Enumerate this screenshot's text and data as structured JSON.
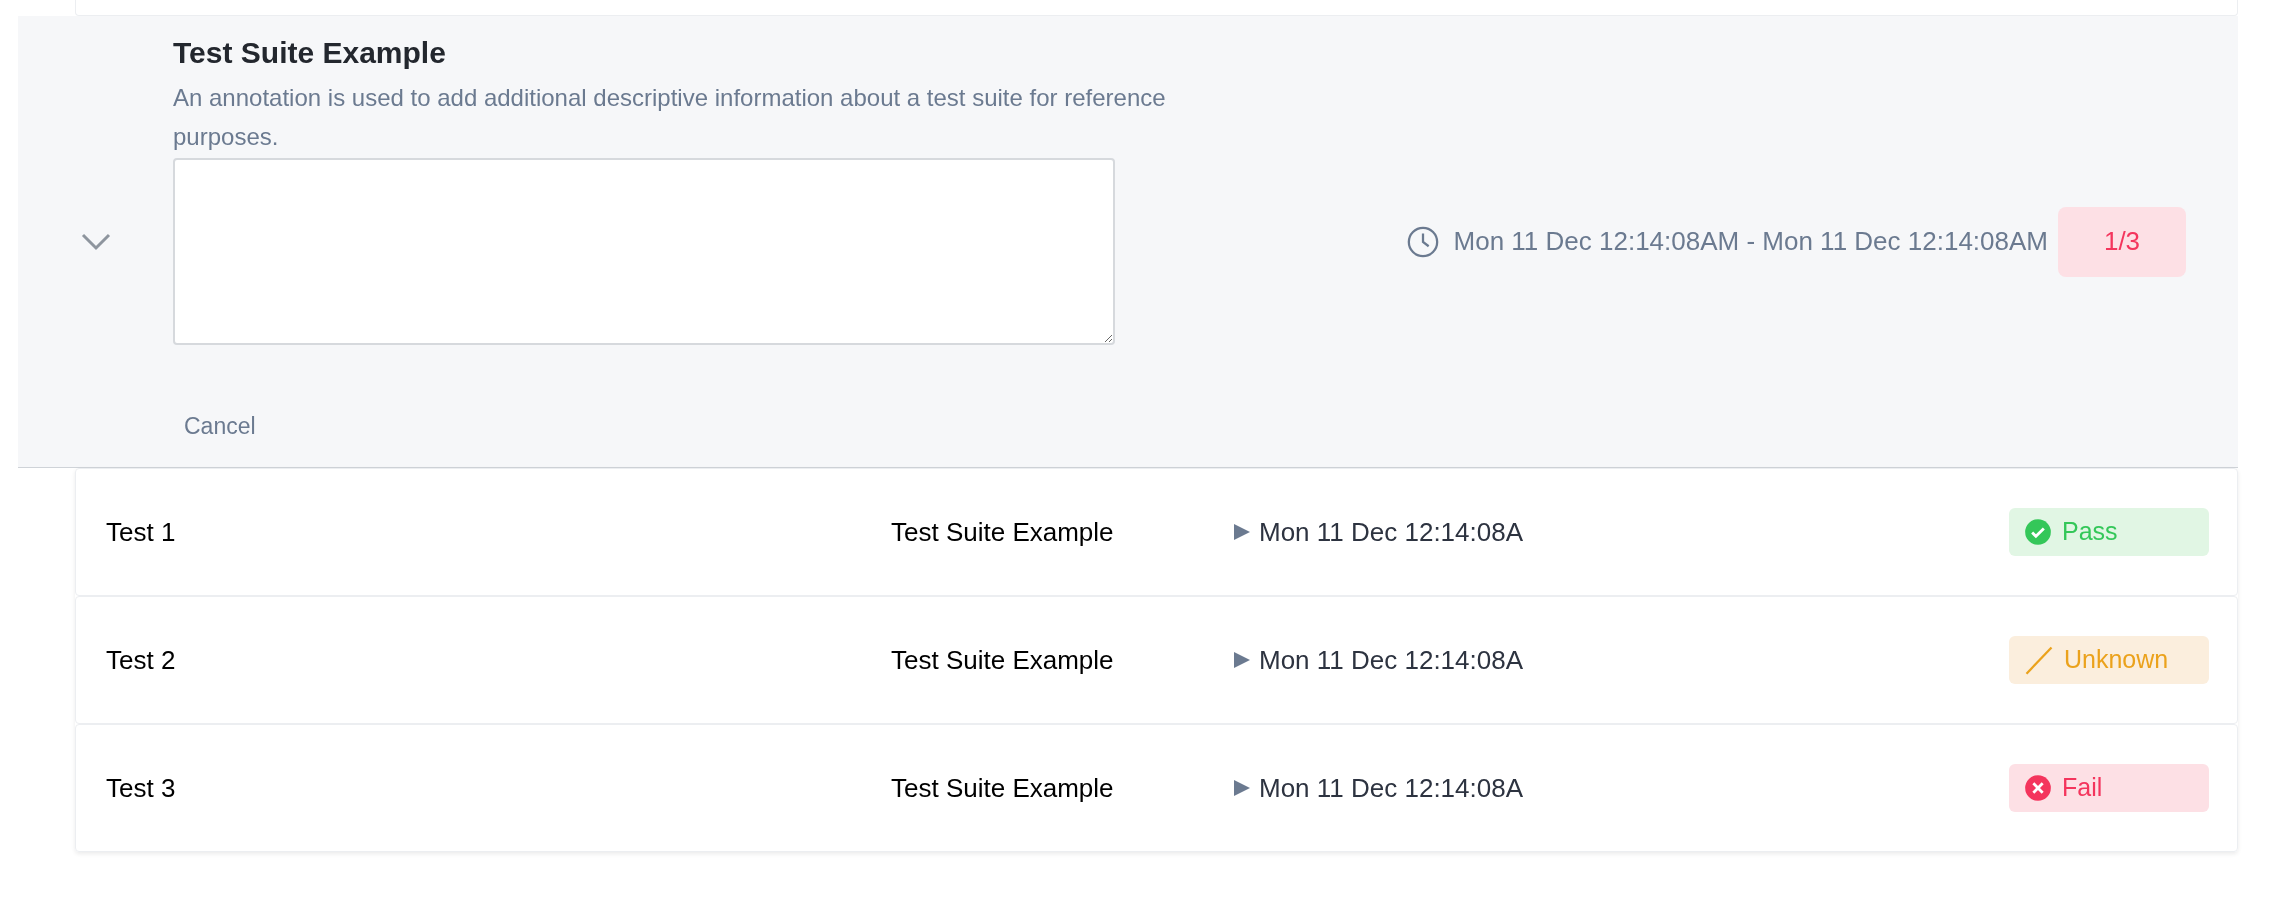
{
  "suite": {
    "title": "Test Suite Example",
    "description": "An annotation is used to add additional descriptive information about a test suite for reference purposes.",
    "cancel": "Cancel",
    "expanded": true,
    "time_range": "Mon 11 Dec 12:14:08AM - Mon 11 Dec 12:14:08AM",
    "count": "1/3"
  },
  "tests": [
    {
      "name": "Test 1",
      "suite": "Test Suite Example",
      "started": "Mon 11 Dec 12:14:08A",
      "kind": "pass",
      "status_label": "Pass"
    },
    {
      "name": "Test 2",
      "suite": "Test Suite Example",
      "started": "Mon 11 Dec 12:14:08A",
      "kind": "unknown",
      "status_label": "Unknown"
    },
    {
      "name": "Test 3",
      "suite": "Test Suite Example",
      "started": "Mon 11 Dec 12:14:08A",
      "kind": "fail",
      "status_label": "Fail"
    }
  ]
}
